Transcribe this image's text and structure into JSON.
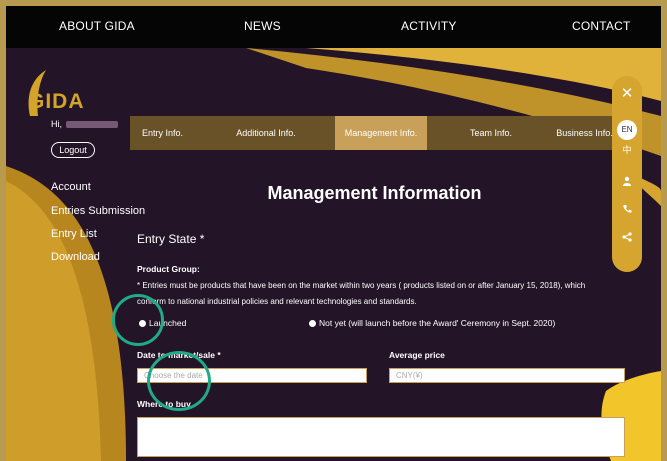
{
  "nav": {
    "items": [
      "ABOUT GIDA",
      "NEWS",
      "ACTIVITY",
      "CONTACT"
    ]
  },
  "brand": {
    "logo_text": "GIDA"
  },
  "user": {
    "greeting": "Hi,",
    "logout_label": "Logout"
  },
  "sidebar": {
    "items": [
      {
        "label": "Account"
      },
      {
        "label": "Entries Submission"
      },
      {
        "label": "Entry List"
      },
      {
        "label": "Download"
      }
    ]
  },
  "tabs": [
    {
      "label": "Entry Info.",
      "active": false
    },
    {
      "label": "Additional Info.",
      "active": false
    },
    {
      "label": "Management Info.",
      "active": true
    },
    {
      "label": "Team Info.",
      "active": false
    },
    {
      "label": "Business Info.",
      "active": false
    }
  ],
  "page": {
    "title": "Management Information",
    "section": "Entry State *",
    "product_group_label": "Product Group:",
    "note_line1": "* Entries must be products that have been on the market within two years ( products listed on or after January 15, 2018), which",
    "note_line2": "conform to national industrial policies and relevant technologies and standards.",
    "radio_launched": "Launched",
    "radio_not_yet": "Not yet (will launch before the Award' Ceremony in Sept. 2020)",
    "date_label": "Date to market/sale *",
    "date_placeholder": "Choose the date",
    "price_label": "Average price",
    "price_placeholder": "CNY(¥)",
    "where_label": "Where to buy"
  },
  "toolbar": {
    "close": "✕",
    "lang_en": "EN",
    "lang_zh": "中",
    "icons": [
      "close-icon",
      "user-icon",
      "phone-icon",
      "share-icon"
    ]
  },
  "colors": {
    "background": "#241428",
    "gold": "#d6a530",
    "tab_active": "#c9a05a",
    "tab_bar": "#6a5228",
    "highlight_ring": "#1faa88"
  }
}
